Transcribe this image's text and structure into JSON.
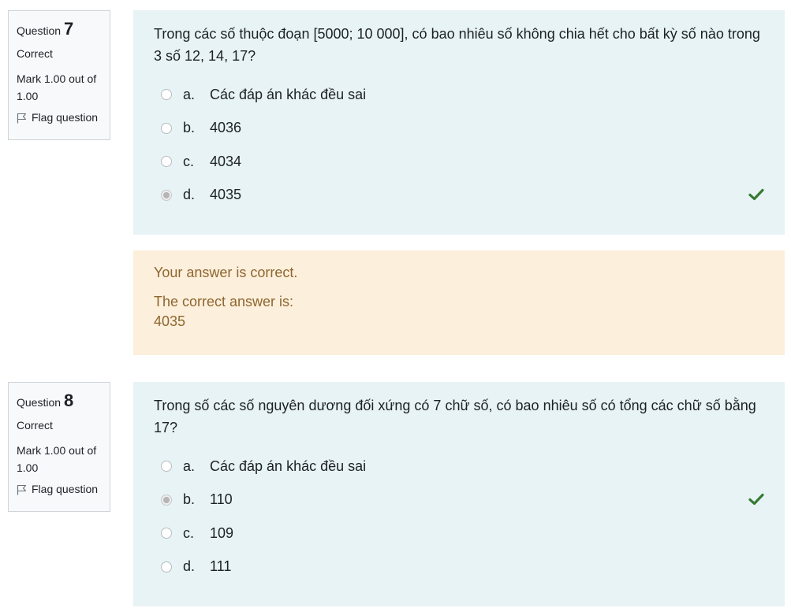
{
  "questions": [
    {
      "label": "Question",
      "number": "7",
      "state": "Correct",
      "grade": "Mark 1.00 out of 1.00",
      "flag_label": "Flag question",
      "text": "Trong các số thuộc đoạn [5000; 10 000], có bao nhiêu số không chia hết cho bất kỳ số nào trong 3 số 12, 14, 17?",
      "answers": [
        {
          "letter": "a.",
          "text": "Các đáp án khác đều sai",
          "selected": false
        },
        {
          "letter": "b.",
          "text": "4036",
          "selected": false
        },
        {
          "letter": "c.",
          "text": "4034",
          "selected": false
        },
        {
          "letter": "d.",
          "text": "4035",
          "selected": true
        }
      ],
      "feedback": {
        "result": "Your answer is correct.",
        "correct_label": "The correct answer is:",
        "correct_value": "4035"
      }
    },
    {
      "label": "Question",
      "number": "8",
      "state": "Correct",
      "grade": "Mark 1.00 out of 1.00",
      "flag_label": "Flag question",
      "text": "Trong số các số nguyên dương đối xứng có 7 chữ số, có bao nhiêu số có tổng các chữ số bằng 17?",
      "answers": [
        {
          "letter": "a.",
          "text": "Các đáp án khác đều sai",
          "selected": false
        },
        {
          "letter": "b.",
          "text": "110",
          "selected": true
        },
        {
          "letter": "c.",
          "text": "109",
          "selected": false
        },
        {
          "letter": "d.",
          "text": "111",
          "selected": false
        }
      ]
    }
  ],
  "colors": {
    "tick": "#357a32",
    "question_bg": "#e7f3f5",
    "feedback_bg": "#fcefdc",
    "feedback_text": "#8e662e"
  }
}
